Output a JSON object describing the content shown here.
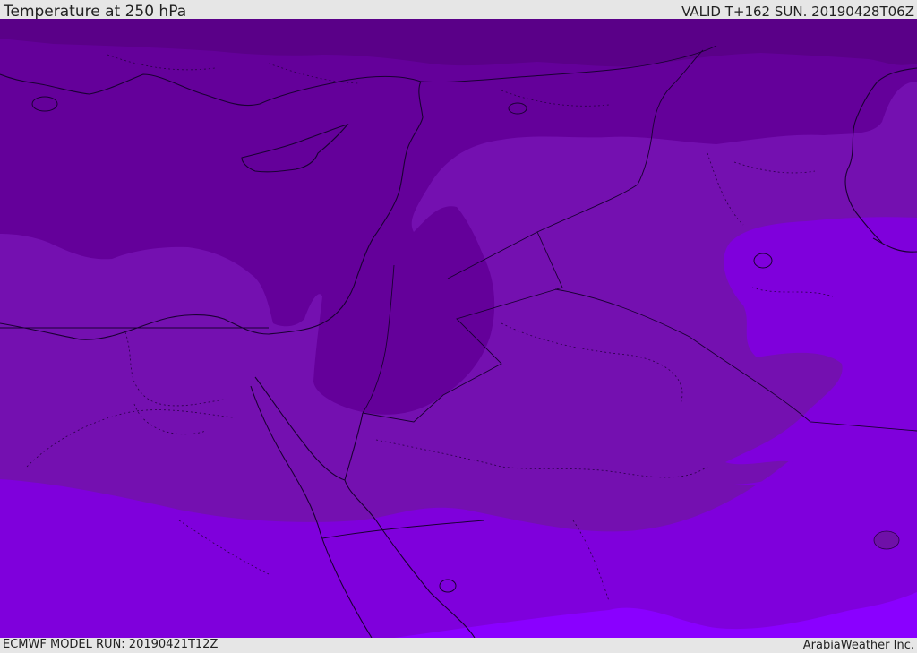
{
  "header": {
    "title": "Temperature at 250 hPa",
    "valid_time": "VALID T+162 SUN. 20190428T06Z"
  },
  "footer": {
    "model_run": "ECMWF MODEL RUN: 20190421T12Z",
    "brand": "ArabiaWeather Inc."
  },
  "colors": {
    "band_darkest": "#5a0088",
    "band_dark": "#64009a",
    "band_mid": "#7410b0",
    "band_light": "#7f00dc",
    "band_lightest": "#8a00ff",
    "coastline": "#1a0033",
    "header_bg": "#e6e6e6"
  }
}
